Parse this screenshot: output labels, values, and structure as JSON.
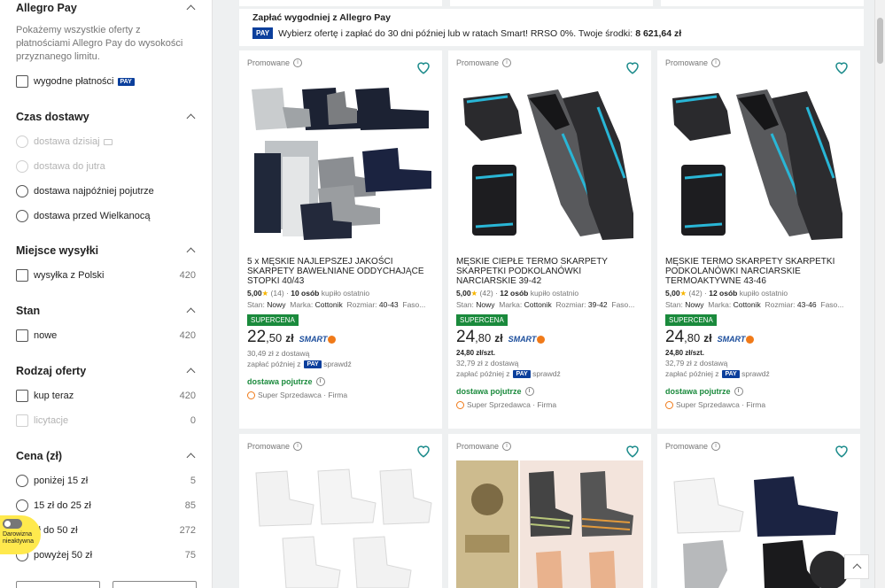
{
  "sidebar": {
    "allegro_pay": {
      "title": "Allegro Pay",
      "description": "Pokażemy wszystkie oferty z płatnościami Allegro Pay do wysokości przyznanego limitu.",
      "option_label": "wygodne płatności",
      "option_badge": "PAY"
    },
    "delivery_time": {
      "title": "Czas dostawy",
      "options": [
        {
          "label": "dostawa dzisiaj",
          "disabled": true
        },
        {
          "label": "dostawa do jutra",
          "disabled": true
        },
        {
          "label": "dostawa najpóźniej pojutrze",
          "disabled": false
        },
        {
          "label": "dostawa przed Wielkanocą",
          "disabled": false
        }
      ]
    },
    "shipping_place": {
      "title": "Miejsce wysyłki",
      "options": [
        {
          "label": "wysyłka z Polski",
          "count": "420"
        }
      ]
    },
    "condition": {
      "title": "Stan",
      "options": [
        {
          "label": "nowe",
          "count": "420"
        }
      ]
    },
    "offer_type": {
      "title": "Rodzaj oferty",
      "options": [
        {
          "label": "kup teraz",
          "count": "420"
        },
        {
          "label": "licytacje",
          "count": "0"
        }
      ]
    },
    "price": {
      "title": "Cena (zł)",
      "options": [
        {
          "label": "poniżej 15 zł",
          "count": "5"
        },
        {
          "label": "15 zł do 25 zł",
          "count": "85"
        },
        {
          "label": "zł do 50 zł",
          "count": "272"
        },
        {
          "label": "powyżej 50 zł",
          "count": "75"
        }
      ]
    }
  },
  "donation": {
    "line1": "Darowizna",
    "line2": "nieaktywna"
  },
  "paybar": {
    "title": "Zapłać wygodniej z Allegro Pay",
    "logo": "PAY",
    "text": "Wybierz ofertę i zapłać do 30 dni później lub w ratach Smart! RRSO 0%. Twoje środki:",
    "amount": "8 621,64 zł"
  },
  "colors": {
    "allegro_pay_blue": "#0b3f9c",
    "supercena_green": "#1a8a3c",
    "smart_orange": "#f07a19",
    "star_yellow": "#f7b500"
  },
  "products": [
    {
      "promo": "Promowane",
      "title": "5 x MĘSKIE NAJLEPSZEJ JAKOŚCI SKARPETY BAWEŁNIANE ODDYCHAJĄCE STOPKI 40/43",
      "rating": "5,00",
      "reviews": "(14)",
      "buyers": "10 osób",
      "buyers_suffix": "kupiło ostatnio",
      "params": {
        "stan_label": "Stan:",
        "stan": "Nowy",
        "marka_label": "Marka:",
        "marka": "Cottonik",
        "rozmiar_label": "Rozmiar:",
        "rozmiar": "40-43",
        "extra": "Faso..."
      },
      "badge": "SUPERCENA",
      "price_main": "22",
      "price_cents": ",50",
      "currency": "zł",
      "smart": "SMART",
      "unit_price": "",
      "with_delivery": "30,49 zł z dostawą",
      "pay_later_prefix": "zapłać później z",
      "pay_badge": "PAY",
      "pay_later_suffix": "sprawdź",
      "delivery": "dostawa pojutrze",
      "seller": "Super Sprzedawca",
      "seller_type": "Firma"
    },
    {
      "promo": "Promowane",
      "title": "MĘSKIE CIEPŁE TERMO SKARPETY SKARPETKI PODKOLANÓWKI NARCIARSKIE 39-42",
      "rating": "5,00",
      "reviews": "(42)",
      "buyers": "12 osób",
      "buyers_suffix": "kupiło ostatnio",
      "params": {
        "stan_label": "Stan:",
        "stan": "Nowy",
        "marka_label": "Marka:",
        "marka": "Cottonik",
        "rozmiar_label": "Rozmiar:",
        "rozmiar": "39-42",
        "extra": "Faso..."
      },
      "badge": "SUPERCENA",
      "price_main": "24",
      "price_cents": ",80",
      "currency": "zł",
      "smart": "SMART",
      "unit_price": "24,80 zł/szt.",
      "with_delivery": "32,79 zł z dostawą",
      "pay_later_prefix": "zapłać później z",
      "pay_badge": "PAY",
      "pay_later_suffix": "sprawdź",
      "delivery": "dostawa pojutrze",
      "seller": "Super Sprzedawca",
      "seller_type": "Firma"
    },
    {
      "promo": "Promowane",
      "title": "MĘSKIE TERMO SKARPETY SKARPETKI PODKOLANÓWKI NARCIARSKIE TERMOAKTYWNE 43-46",
      "rating": "5,00",
      "reviews": "(42)",
      "buyers": "12 osób",
      "buyers_suffix": "kupiło ostatnio",
      "params": {
        "stan_label": "Stan:",
        "stan": "Nowy",
        "marka_label": "Marka:",
        "marka": "Cottonik",
        "rozmiar_label": "Rozmiar:",
        "rozmiar": "43-46",
        "extra": "Faso..."
      },
      "badge": "SUPERCENA",
      "price_main": "24",
      "price_cents": ",80",
      "currency": "zł",
      "smart": "SMART",
      "unit_price": "24,80 zł/szt.",
      "with_delivery": "32,79 zł z dostawą",
      "pay_later_prefix": "zapłać później z",
      "pay_badge": "PAY",
      "pay_later_suffix": "sprawdź",
      "delivery": "dostawa pojutrze",
      "seller": "Super Sprzedawca",
      "seller_type": "Firma"
    },
    {
      "promo": "Promowane"
    },
    {
      "promo": "Promowane"
    },
    {
      "promo": "Promowane"
    }
  ]
}
